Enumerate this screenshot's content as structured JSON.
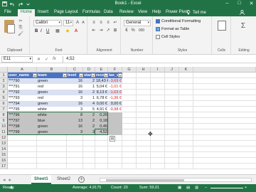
{
  "window": {
    "title": "Book1 - Excel",
    "controls": [
      "–",
      "□",
      "✕"
    ]
  },
  "ribbon_tabs": [
    "File",
    "Home",
    "Insert",
    "Page Layout",
    "Formulas",
    "Data",
    "Review",
    "View",
    "Help",
    "Power Pivot"
  ],
  "tell_me": "Tell me",
  "ribbon": {
    "clipboard_label": "Clipboard",
    "font_name": "Calibri",
    "font_size": "11",
    "bold": "B",
    "italic": "I",
    "underline": "U",
    "font_label": "Font",
    "alignment_label": "Alignment",
    "number_format": "General",
    "number_label": "Number",
    "conditional_formatting": "Conditional Formatting",
    "format_as_table": "Format as Table",
    "cell_styles": "Cell Styles",
    "styles_label": "Styles",
    "cells_label": "Cells",
    "editing_label": "Editing",
    "percent": "%",
    "comma": "000"
  },
  "formula_bar": {
    "name_box": "E11",
    "fx": "fx",
    "value": "4,52"
  },
  "columns": [
    "A",
    "B",
    "C",
    "D",
    "E",
    "F",
    "G",
    "H",
    "I",
    "J",
    "K"
  ],
  "rows": [
    "1",
    "2",
    "3",
    "4",
    "5",
    "6",
    "7",
    "8",
    "9",
    "10",
    "11",
    "12",
    "13",
    "14",
    "15",
    "16",
    "17"
  ],
  "table": {
    "headers": [
      "user_name",
      "team",
      "level",
      "stars",
      "recentB",
      "tax_sh"
    ],
    "rows": [
      [
        "***790",
        "green",
        "16",
        "2",
        "18,43 €",
        "-3,69 €"
      ],
      [
        "***791",
        "red",
        "16",
        "1",
        "5,04 €",
        "-1,01 €"
      ],
      [
        "***792",
        "green",
        "16",
        "2",
        "8,13 €",
        "-1,63 €"
      ],
      [
        "***793",
        "red",
        "3",
        "1",
        "6,78 €",
        "-1,36 €"
      ],
      [
        "***794",
        "green",
        "16",
        "4",
        "0,00 €",
        "0,00 €"
      ],
      [
        "***795",
        "white",
        "3",
        "5",
        "4,91 €",
        "-0,98 €"
      ],
      [
        "***796",
        "white",
        "8",
        "2",
        "0,26",
        ""
      ],
      [
        "***797",
        "blue",
        "13",
        "2",
        "0,18",
        ""
      ],
      [
        "***798",
        "green",
        "16",
        "2",
        "0,45",
        ""
      ],
      [
        "***799",
        "green",
        "3",
        "3",
        "4,52",
        ""
      ]
    ]
  },
  "sheets": [
    "Sheet1",
    "Sheet2"
  ],
  "status": {
    "mode": "Ready",
    "average": "Average: 4,9175",
    "count": "Count: 20",
    "sum": "Sum: 59,01"
  },
  "colors": {
    "accent": "#217346",
    "table_header": "#4a72c4",
    "band": "#d9e1f2",
    "selection": "#c4c4c4",
    "negative": "#e0201a"
  }
}
